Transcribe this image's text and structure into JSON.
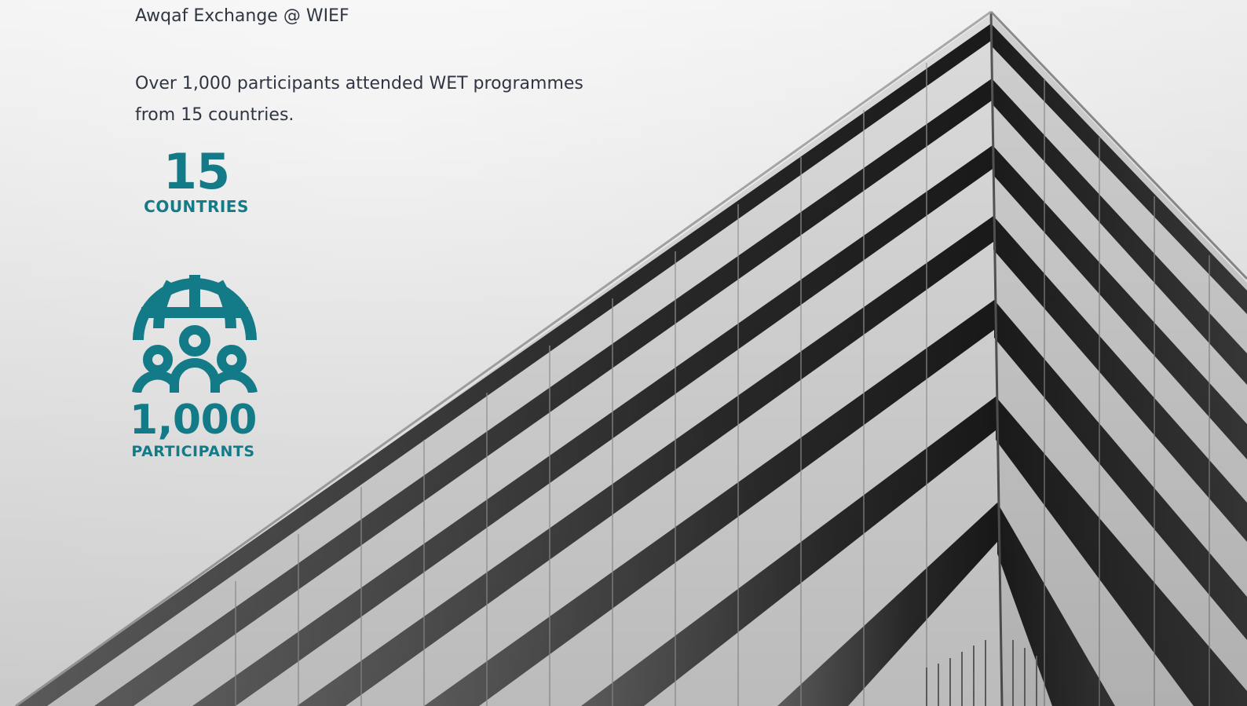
{
  "header": {
    "event_line": "Awqaf Exchange @ WIEF"
  },
  "summary": {
    "line1": "Over 1,000 participants attended WET programmes",
    "line2": "from 15 countries."
  },
  "stats": {
    "countries": {
      "value": "15",
      "label": "COUNTRIES"
    },
    "participants": {
      "value": "1,000",
      "label": "PARTICIPANTS",
      "icon": "globe-people-icon"
    }
  },
  "colors": {
    "accent": "#137a87",
    "body_text": "#2f3642"
  }
}
